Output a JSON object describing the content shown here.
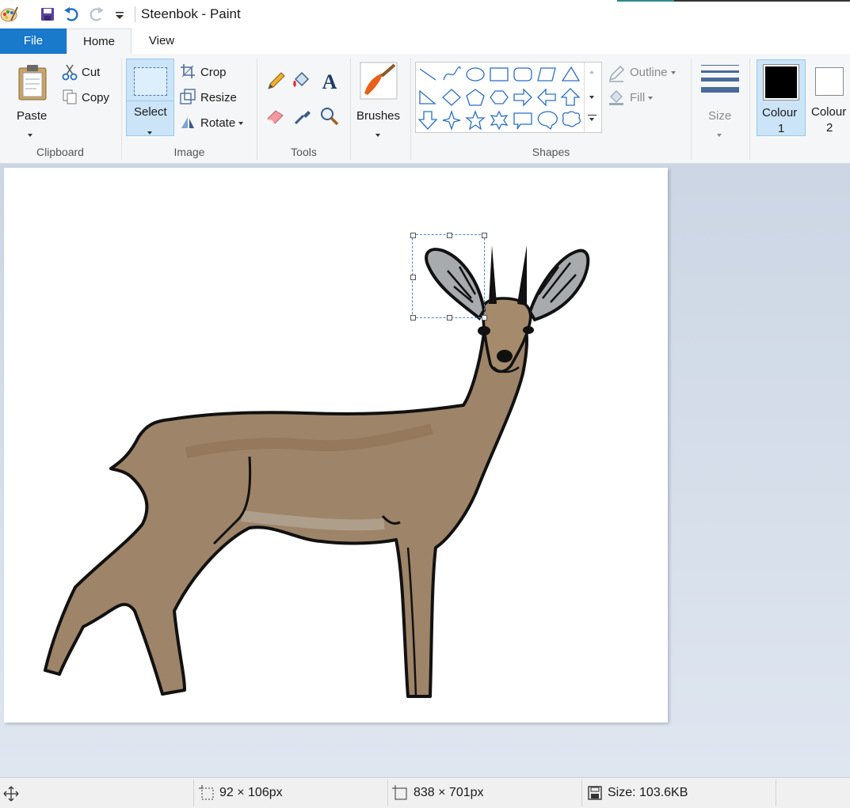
{
  "window": {
    "title": "Steenbok - Paint"
  },
  "tabs": {
    "file": "File",
    "home": "Home",
    "view": "View"
  },
  "clipboard": {
    "paste": "Paste",
    "cut": "Cut",
    "copy": "Copy",
    "group": "Clipboard"
  },
  "image": {
    "select": "Select",
    "crop": "Crop",
    "resize": "Resize",
    "rotate": "Rotate",
    "group": "Image"
  },
  "tools": {
    "group": "Tools"
  },
  "brushes": {
    "label": "Brushes"
  },
  "shapes": {
    "outline": "Outline",
    "fill": "Fill",
    "group": "Shapes"
  },
  "size": {
    "label": "Size"
  },
  "colours": {
    "colour1_top": "Colour",
    "colour1_bottom": "1",
    "colour2_top": "Colour",
    "colour2_bottom": "2",
    "colour1_value": "#000000",
    "colour2_value": "#ffffff"
  },
  "status": {
    "selection_size": "92 × 106px",
    "image_size": "838 × 701px",
    "file_size": "Size: 103.6KB"
  },
  "icons": [
    "paint-app-icon",
    "save-icon",
    "undo-icon",
    "redo-icon",
    "customize-icon",
    "paste-icon",
    "cut-icon",
    "copy-icon",
    "select-icon",
    "crop-icon",
    "resize-icon",
    "rotate-icon",
    "pencil-icon",
    "fill-bucket-icon",
    "text-icon",
    "eraser-icon",
    "color-picker-icon",
    "magnifier-icon",
    "brush-icon",
    "outline-icon",
    "fill-icon",
    "move-icon",
    "selection-size-icon",
    "image-size-icon",
    "disk-icon"
  ]
}
